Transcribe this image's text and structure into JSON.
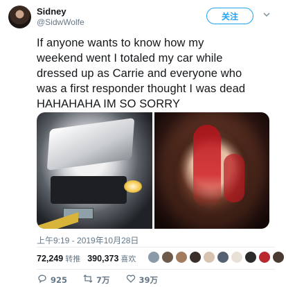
{
  "author": {
    "name": "Sidney",
    "handle": "@SidwWolfe"
  },
  "header": {
    "follow_label": "关注",
    "menu_icon": "chevron-down-icon"
  },
  "tweet": {
    "text": "If anyone wants to know how my\nweekend went I totaled my car while\ndressed up as Carrie and everyone who\nwas a first responder thought I was dead\nHAHAHAHA IM SO SORRY",
    "timestamp": "上午9:19 - 2019年10月28日"
  },
  "media": [
    {
      "subject": "wrecked-car-photo"
    },
    {
      "subject": "costume-face-photo"
    }
  ],
  "stats": {
    "retweets_count": "72,249",
    "retweets_label": "转推",
    "likes_count": "390,373",
    "likes_label": "喜欢"
  },
  "likers": [
    {
      "color": "#8a9aa8"
    },
    {
      "color": "#6d5a4a"
    },
    {
      "color": "#a37b5f"
    },
    {
      "color": "#3a2e2a"
    },
    {
      "color": "#d7c3b0"
    },
    {
      "color": "#556070"
    },
    {
      "color": "#e9e1d8"
    },
    {
      "color": "#2b2b2b"
    },
    {
      "color": "#b8282e"
    },
    {
      "color": "#4a3a32"
    }
  ],
  "actions": {
    "reply_count": "925",
    "retweet_count": "7万",
    "like_count": "39万"
  },
  "colors": {
    "accent": "#1da1f2",
    "secondary_text": "#657786",
    "primary_text": "#14171a"
  }
}
